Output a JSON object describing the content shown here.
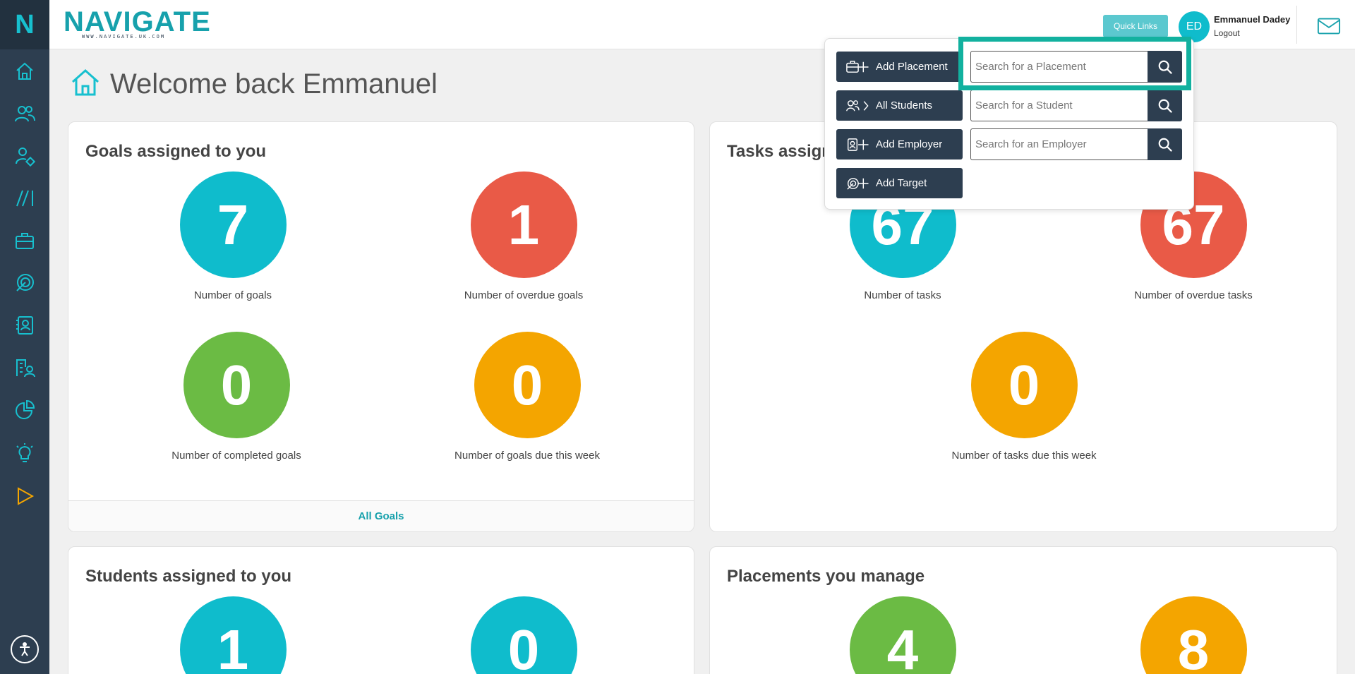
{
  "brand": {
    "wordmark": "NAVIGATE",
    "url": "WWW.NAVIGATE.UK.COM",
    "sidebar_letter": "N"
  },
  "header": {
    "quick_links_label": "Quick Links",
    "avatar_initials": "ED",
    "user_name": "Emmanuel Dadey",
    "logout_label": "Logout"
  },
  "sidebar": {
    "items": [
      {
        "icon": "home-icon"
      },
      {
        "icon": "users-icon"
      },
      {
        "icon": "user-tag-icon"
      },
      {
        "icon": "slashes-icon"
      },
      {
        "icon": "briefcase-icon"
      },
      {
        "icon": "target-icon"
      },
      {
        "icon": "contact-card-icon"
      },
      {
        "icon": "building-user-icon"
      },
      {
        "icon": "pie-chart-icon"
      },
      {
        "icon": "lightbulb-icon"
      },
      {
        "icon": "play-icon"
      }
    ],
    "accessibility_icon": "accessibility-icon"
  },
  "page": {
    "title": "Welcome back Emmanuel"
  },
  "goals_card": {
    "title": "Goals assigned to you",
    "stats": [
      {
        "value": "7",
        "label": "Number of goals",
        "color": "#0fbccc"
      },
      {
        "value": "1",
        "label": "Number of overdue goals",
        "color": "#e95a47"
      },
      {
        "value": "0",
        "label": "Number of completed goals",
        "color": "#6bbb44"
      },
      {
        "value": "0",
        "label": "Number of goals due this week",
        "color": "#f4a500"
      }
    ],
    "footer_link": "All Goals"
  },
  "tasks_card": {
    "title": "Tasks assign",
    "stats": [
      {
        "value": "67",
        "label": "Number of tasks",
        "color": "#0fbccc"
      },
      {
        "value": "67",
        "label": "Number of overdue tasks",
        "color": "#e95a47"
      },
      {
        "value": "0",
        "label": "Number of tasks due this week",
        "color": "#f4a500"
      }
    ]
  },
  "students_card": {
    "title": "Students assigned to you",
    "stats": [
      {
        "value": "1",
        "color": "#0fbccc"
      },
      {
        "value": "0",
        "color": "#0fbccc"
      }
    ]
  },
  "placements_card": {
    "title": "Placements you manage",
    "stats": [
      {
        "value": "4",
        "color": "#6bbb44"
      },
      {
        "value": "8",
        "color": "#f4a500"
      }
    ]
  },
  "quick_links": {
    "actions": [
      {
        "label": "Add Placement",
        "icon": "briefcase-icon"
      },
      {
        "label": "All Students",
        "icon": "users-icon"
      },
      {
        "label": "Add Employer",
        "icon": "contact-card-icon"
      },
      {
        "label": "Add Target",
        "icon": "target-icon"
      }
    ],
    "searches": [
      {
        "placeholder": "Search for a Placement"
      },
      {
        "placeholder": "Search for a Student"
      },
      {
        "placeholder": "Search for an Employer"
      }
    ]
  },
  "colors": {
    "brand_teal": "#17a1ac",
    "sidebar": "#2d3e50",
    "highlight": "#12b19f"
  }
}
